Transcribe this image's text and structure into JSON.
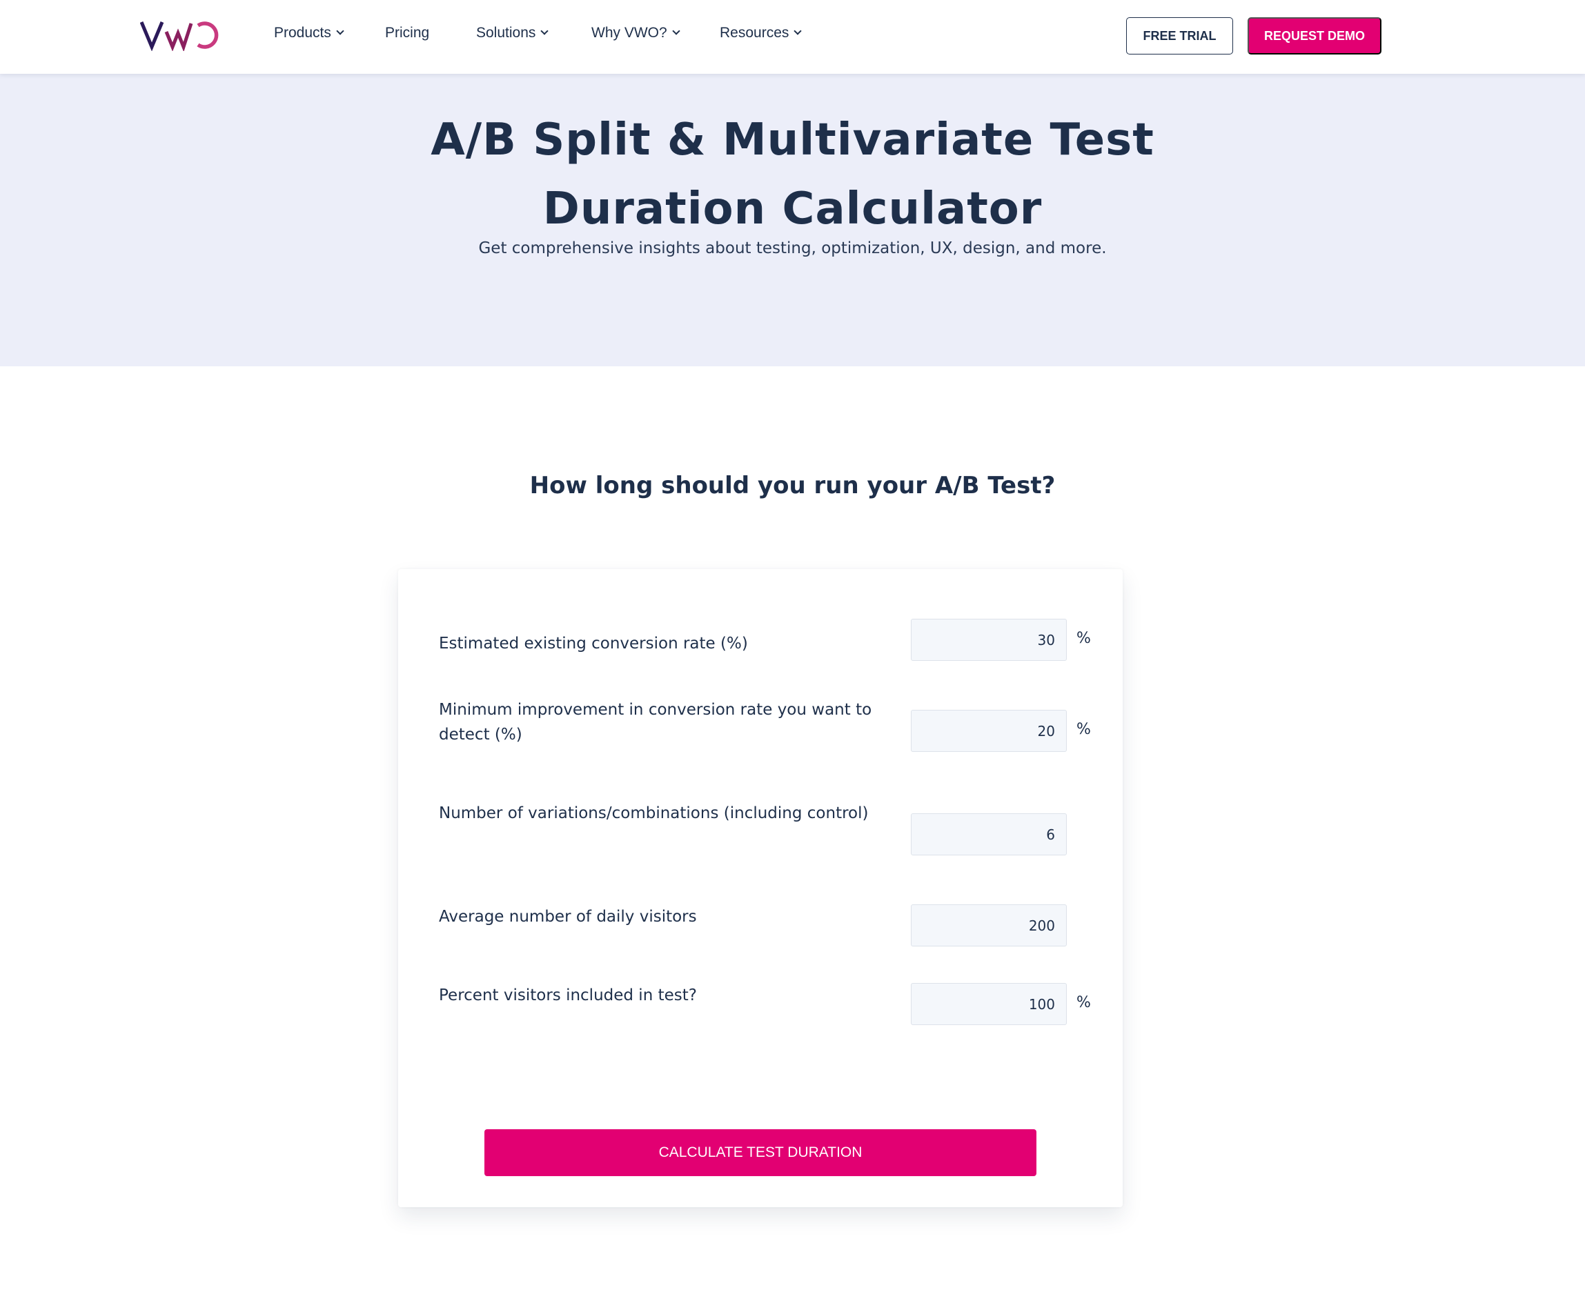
{
  "brand": {
    "logo_text": "VWO",
    "colors": {
      "primary": "#e20072",
      "navy": "#1e2f4a",
      "hero_bg": "#eceef9",
      "input_bg": "#f4f7fb",
      "logo_v": "#2b1a5a",
      "logo_w": "#8a1f5e",
      "logo_o": "#c93a7f"
    }
  },
  "nav": {
    "items": [
      {
        "label": "Products",
        "has_dropdown": true,
        "icon": "chevron-down-icon"
      },
      {
        "label": "Pricing",
        "has_dropdown": false
      },
      {
        "label": "Solutions",
        "has_dropdown": true,
        "icon": "chevron-down-icon"
      },
      {
        "label": "Why VWO?",
        "has_dropdown": true,
        "icon": "chevron-down-icon"
      },
      {
        "label": "Resources",
        "has_dropdown": true,
        "icon": "chevron-down-icon"
      }
    ],
    "free_trial_label": "FREE TRIAL",
    "request_demo_label": "REQUEST DEMO"
  },
  "hero": {
    "title_line1": "A/B Split & Multivariate Test",
    "title_line2": "Duration Calculator",
    "subtitle": "Get comprehensive insights about testing, optimization, UX, design, and more."
  },
  "calculator": {
    "heading": "How long should you run your A/B Test?",
    "fields": [
      {
        "label": "Estimated existing conversion rate (%)",
        "value": "30",
        "unit": "%"
      },
      {
        "label": "Minimum improvement in conversion rate you want to detect (%)",
        "value": "20",
        "unit": "%"
      },
      {
        "label": "Number of variations/combinations (including control)",
        "value": "6",
        "unit": ""
      },
      {
        "label": "Average number of daily visitors",
        "value": "200",
        "unit": ""
      },
      {
        "label": "Percent visitors included in test?",
        "value": "100",
        "unit": "%"
      }
    ],
    "submit_label": "CALCULATE TEST DURATION"
  }
}
